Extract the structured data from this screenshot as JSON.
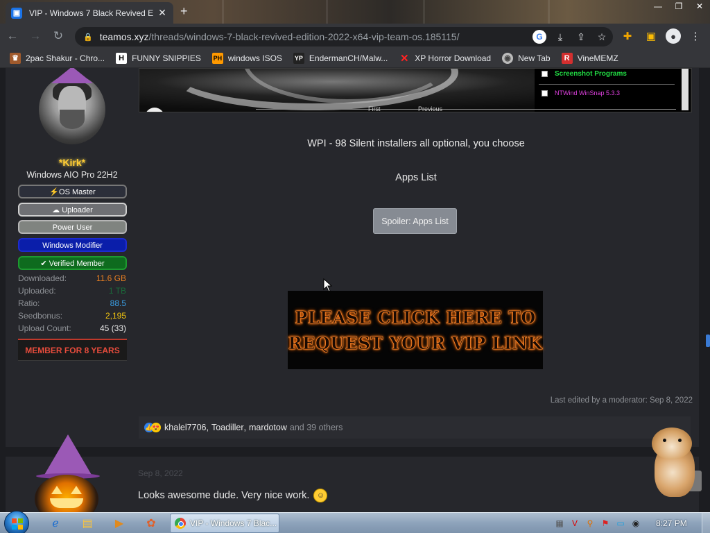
{
  "browser": {
    "tab_title": "VIP - Windows 7 Black Revived E",
    "tab_favicon": "VIP",
    "address_host": "teamos.xyz",
    "address_path": "/threads/windows-7-black-revived-edition-2022-x64-vip-team-os.185115/"
  },
  "bookmarks": [
    {
      "label": "2pac Shakur - Chro...",
      "icon": "tupac-icon"
    },
    {
      "label": "FUNNY SNIPPIES",
      "icon": "H-icon"
    },
    {
      "label": "windows ISOS",
      "icon": "PH-icon"
    },
    {
      "label": "EndermanCH/Malw...",
      "icon": "YP-icon"
    },
    {
      "label": "XP Horror Download",
      "icon": "X-icon"
    },
    {
      "label": "New Tab",
      "icon": "new-tab-icon"
    },
    {
      "label": "VineMEMZ",
      "icon": "R-icon"
    }
  ],
  "installer_preview": {
    "item1": "Screenshot Programs",
    "item2": "NTWind WinSnap 5.3.3",
    "nav_first": "First",
    "nav_prev": "Previous"
  },
  "user": {
    "name": "*Kirk*",
    "title": "Windows AIO Pro 22H2",
    "badges": {
      "os_master": "⚡OS Master",
      "uploader": "☁ Uploader",
      "power_user": "Power User",
      "windows_modifier": "Windows Modifier",
      "verified_member": "✔ Verified Member"
    },
    "stats": [
      {
        "label": "Downloaded:",
        "value": "11.6 GB",
        "color": "#e67e22"
      },
      {
        "label": "Uploaded:",
        "value": "1 TB",
        "color": "#1a6b3a"
      },
      {
        "label": "Ratio:",
        "value": "88.5",
        "color": "#3aa0e8"
      },
      {
        "label": "Seedbonus:",
        "value": "2,195",
        "color": "#f1c40f"
      },
      {
        "label": "Upload Count:",
        "value": "45 (33)",
        "color": "#e8e8e8"
      }
    ],
    "member_for": "MEMBER FOR 8 YEARS"
  },
  "post": {
    "wpi_text": "WPI - 98 Silent installers all optional, you choose",
    "apps_list_heading": "Apps List",
    "spoiler_button": "Spoiler: Apps List",
    "banner_line1": "PLEASE CLICK HERE TO",
    "banner_line2": "REQUEST YOUR VIP LINK",
    "edited_note": "Last edited by a moderator: Sep 8, 2022",
    "reactions": {
      "user1": "khalel7706",
      "user2": "Toadiller",
      "user3": "mardotow",
      "rest": "and 39 others"
    }
  },
  "post2": {
    "date": "Sep 8, 2022",
    "message": "Looks awesome dude. Very nice work."
  },
  "taskbar": {
    "chrome_task_title": "VIP - Windows 7 Blac...",
    "clock": "8:27 PM"
  }
}
